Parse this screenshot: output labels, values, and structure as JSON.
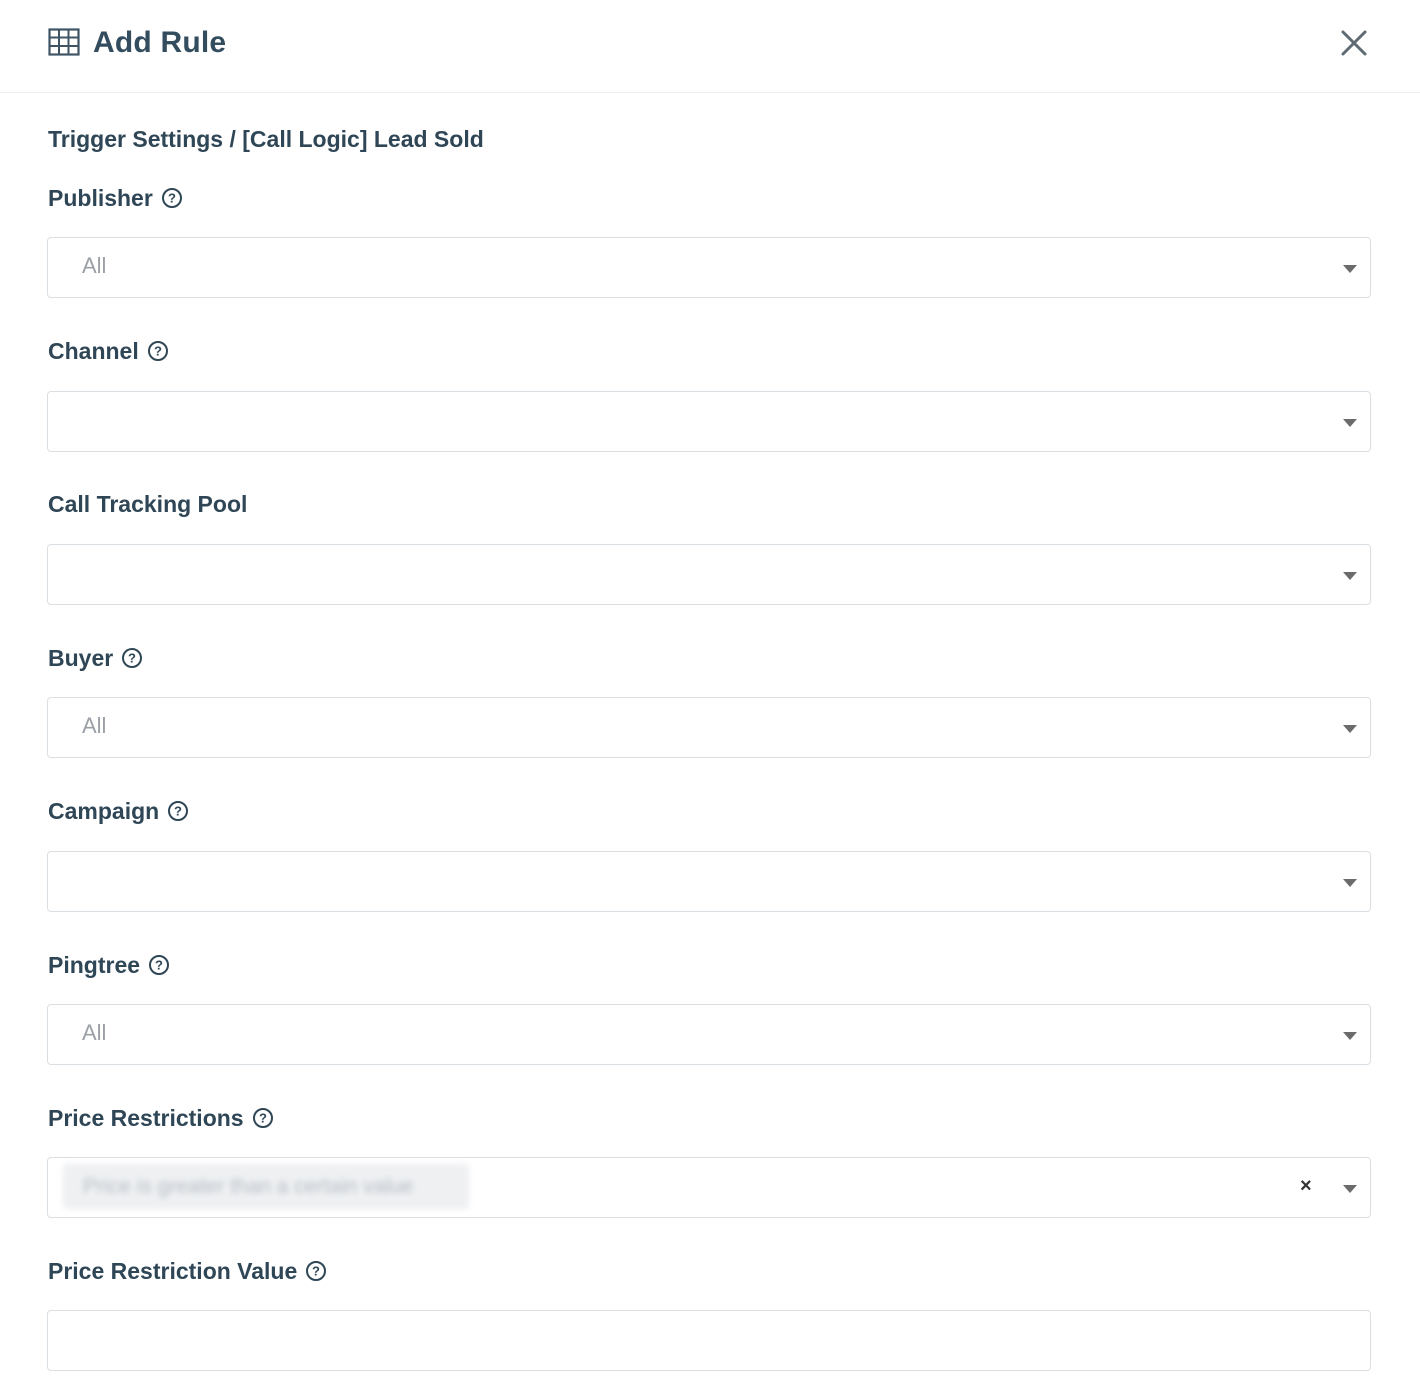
{
  "modal": {
    "title": "Add Rule",
    "section_title": "Trigger Settings / [Call Logic] Lead Sold"
  },
  "fields": {
    "publisher": {
      "label": "Publisher",
      "value": "All"
    },
    "channel": {
      "label": "Channel",
      "value": ""
    },
    "call_tracking_pool": {
      "label": "Call Tracking Pool",
      "value": ""
    },
    "buyer": {
      "label": "Buyer",
      "value": "All"
    },
    "campaign": {
      "label": "Campaign",
      "value": ""
    },
    "pingtree": {
      "label": "Pingtree",
      "value": "All"
    },
    "price_restrictions": {
      "label": "Price Restrictions",
      "selected_tag": "Price is greater than a certain value",
      "clear_glyph": "×"
    },
    "price_restriction_value": {
      "label": "Price Restriction Value",
      "value": ""
    }
  },
  "colors": {
    "label_text": "#2f4656",
    "placeholder_text": "#9aa0a6",
    "border": "#dadfe3",
    "icon": "#4a5a66"
  },
  "icons": {
    "header": "table-grid-icon",
    "close": "close-icon",
    "help": "question-circle-icon",
    "dropdown": "caret-down-icon"
  }
}
